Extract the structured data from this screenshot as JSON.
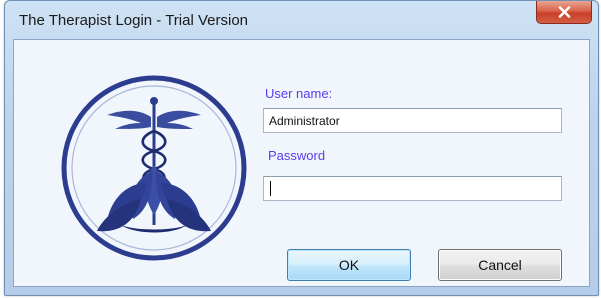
{
  "window": {
    "title": "The Therapist Login - Trial Version"
  },
  "close_button": {
    "icon": "close-icon"
  },
  "logo": {
    "icon": "caduceus-lotus-logo"
  },
  "form": {
    "username_label": "User name:",
    "username_value": "Administrator",
    "password_label": "Password",
    "password_value": ""
  },
  "buttons": {
    "ok_label": "OK",
    "cancel_label": "Cancel"
  },
  "colors": {
    "label": "#5a3cf0",
    "logo": "#2c3c8f",
    "close_button": "#c7412a"
  }
}
